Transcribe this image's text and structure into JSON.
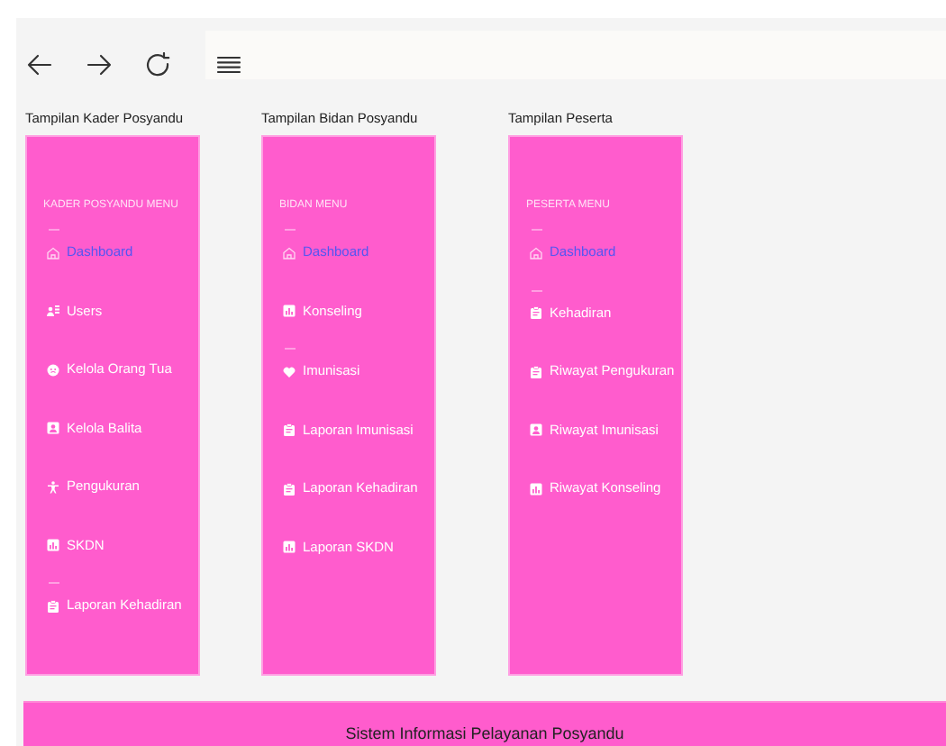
{
  "panels": [
    {
      "title": "Tampilan Kader Posyandu",
      "menu_header": "KADER POSYANDU MENU",
      "items": [
        {
          "label": "Dashboard",
          "selected": true,
          "divider_before": true
        },
        {
          "label": "Users",
          "selected": false,
          "divider_before": false
        },
        {
          "label": "Kelola Orang Tua",
          "selected": false,
          "divider_before": false
        },
        {
          "label": "Kelola Balita",
          "selected": false,
          "divider_before": false
        },
        {
          "label": "Pengukuran",
          "selected": false,
          "divider_before": false
        },
        {
          "label": "SKDN",
          "selected": false,
          "divider_before": false
        },
        {
          "label": "Laporan Kehadiran",
          "selected": false,
          "divider_before": true
        }
      ]
    },
    {
      "title": "Tampilan Bidan Posyandu",
      "menu_header": "BIDAN MENU",
      "items": [
        {
          "label": "Dashboard",
          "selected": true,
          "divider_before": true
        },
        {
          "label": "Konseling",
          "selected": false,
          "divider_before": false
        },
        {
          "label": "Imunisasi",
          "selected": false,
          "divider_before": true
        },
        {
          "label": "Laporan Imunisasi",
          "selected": false,
          "divider_before": false
        },
        {
          "label": "Laporan Kehadiran",
          "selected": false,
          "divider_before": false
        },
        {
          "label": "Laporan SKDN",
          "selected": false,
          "divider_before": false
        }
      ]
    },
    {
      "title": "Tampilan Peserta",
      "menu_header": "PESERTA MENU",
      "items": [
        {
          "label": "Dashboard",
          "selected": true,
          "divider_before": true
        },
        {
          "label": "Kehadiran",
          "selected": false,
          "divider_before": true
        },
        {
          "label": "Riwayat Pengukuran",
          "selected": false,
          "divider_before": false
        },
        {
          "label": "Riwayat Imunisasi",
          "selected": false,
          "divider_before": false
        },
        {
          "label": "Riwayat Konseling",
          "selected": false,
          "divider_before": false
        }
      ]
    }
  ],
  "footer": {
    "text": "Sistem Informasi Pelayanan Posyandu"
  }
}
